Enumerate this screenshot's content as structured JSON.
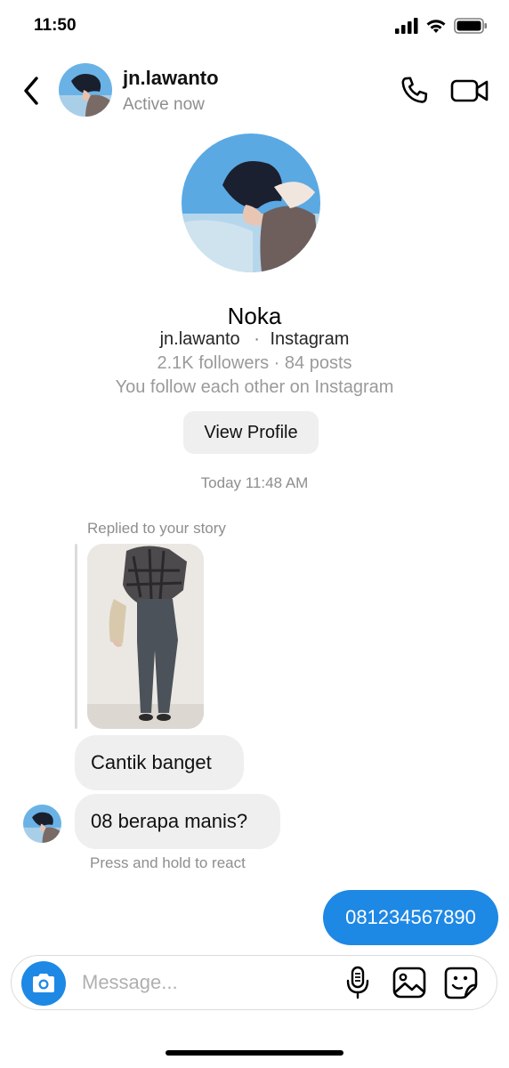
{
  "status_bar": {
    "time": "11:50",
    "icons": [
      "signal-icon",
      "wifi-icon",
      "battery-icon"
    ]
  },
  "header": {
    "username": "jn.lawanto",
    "status": "Active now",
    "icons": [
      "back-icon",
      "phone-icon",
      "video-camera-icon"
    ]
  },
  "profile": {
    "name": "Noka",
    "handle": "jn.lawanto",
    "separator": "·",
    "platform": "Instagram",
    "stats": "2.1K followers · 84 posts",
    "mutual": "You follow each other on Instagram",
    "view_profile_label": "View Profile"
  },
  "chat": {
    "timestamp": "Today 11:48 AM",
    "reply_label": "Replied to your story",
    "incoming": [
      {
        "text": "Cantik banget"
      },
      {
        "text": "08 berapa manis?"
      }
    ],
    "react_hint": "Press and hold to react",
    "outgoing": [
      {
        "text": "081234567890"
      }
    ]
  },
  "composer": {
    "placeholder": "Message...",
    "icons": [
      "camera-icon",
      "microphone-icon",
      "gallery-icon",
      "sticker-icon"
    ]
  },
  "colors": {
    "accent": "#1e88e5",
    "bubble_incoming": "#efefef",
    "secondary_text": "#8e8e8e"
  }
}
